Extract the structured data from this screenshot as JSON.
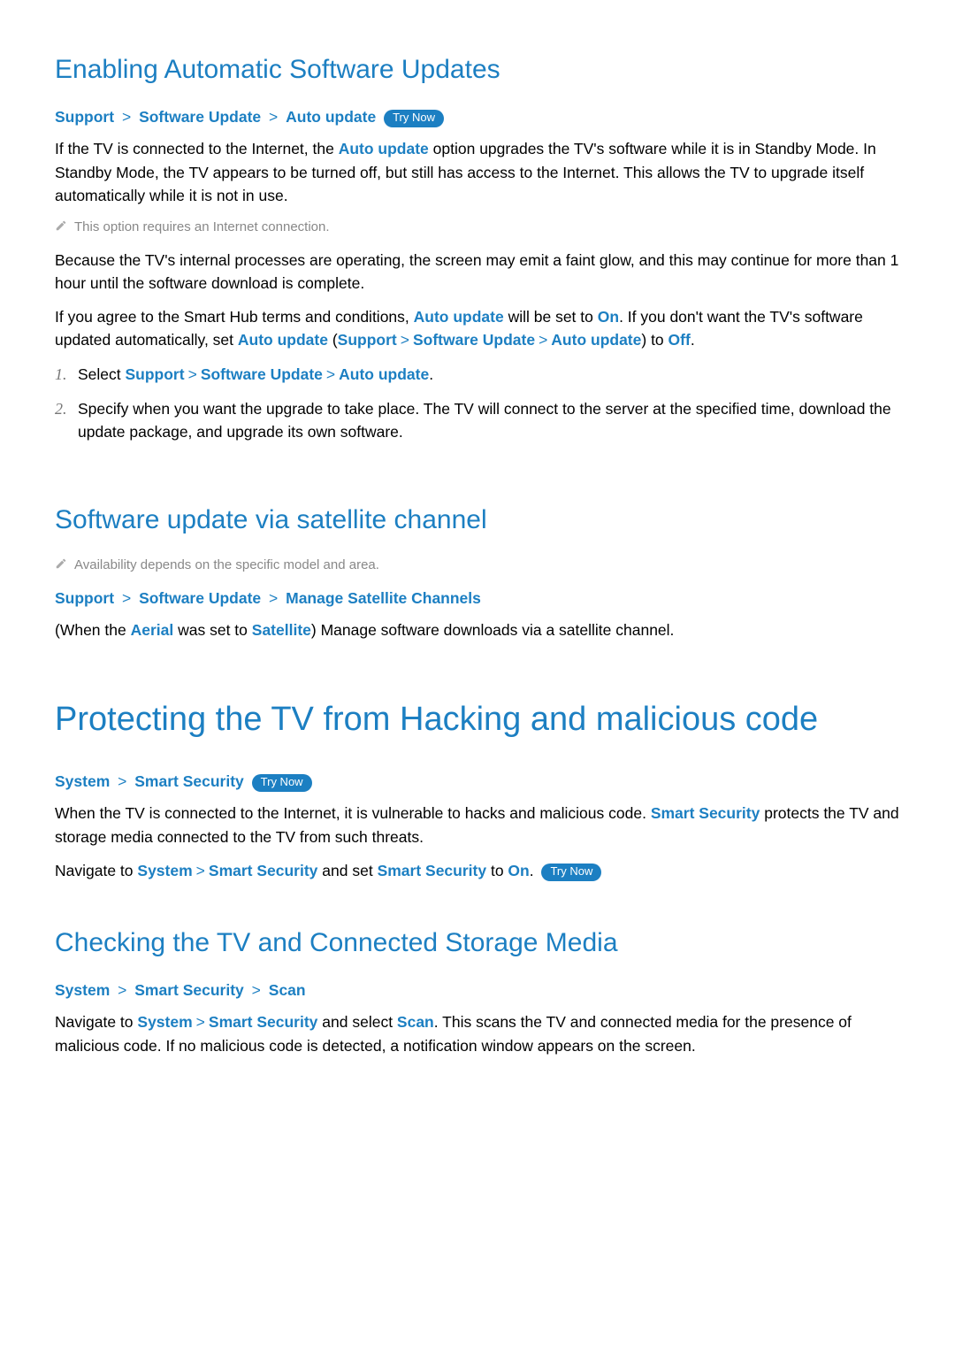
{
  "sec1": {
    "title": "Enabling Automatic Software Updates",
    "bc": {
      "a": "Support",
      "b": "Software Update",
      "c": "Auto update",
      "try": "Try Now"
    },
    "p1a": "If the TV is connected to the Internet, the ",
    "p1b": "Auto update",
    "p1c": " option upgrades the TV's software while it is in Standby Mode. In Standby Mode, the TV appears to be turned off, but still has access to the Internet. This allows the TV to upgrade itself automatically while it is not in use.",
    "note1": "This option requires an Internet connection.",
    "p2": "Because the TV's internal processes are operating, the screen may emit a faint glow, and this may continue for more than 1 hour until the software download is complete.",
    "p3a": "If you agree to the Smart Hub terms and conditions, ",
    "p3b": "Auto update",
    "p3c": " will be set to ",
    "p3d": "On",
    "p3e": ". If you don't want the TV's software updated automatically, set ",
    "p3f": "Auto update",
    "p3g": " (",
    "p3h": "Support",
    "p3i": "Software Update",
    "p3j": "Auto update",
    "p3k": ") to ",
    "p3l": "Off",
    "p3m": ".",
    "step1a": "Select ",
    "step1b": "Support",
    "step1c": "Software Update",
    "step1d": "Auto update",
    "step1e": ".",
    "step2": "Specify when you want the upgrade to take place. The TV will connect to the server at the specified time, download the update package, and upgrade its own software."
  },
  "sec2": {
    "title": "Software update via satellite channel",
    "note": "Availability depends on the specific model and area.",
    "bc": {
      "a": "Support",
      "b": "Software Update",
      "c": "Manage Satellite Channels"
    },
    "p1a": "(When the ",
    "p1b": "Aerial",
    "p1c": " was set to ",
    "p1d": "Satellite",
    "p1e": ") Manage software downloads via a satellite channel."
  },
  "sec3": {
    "title": "Protecting the TV from Hacking and malicious code",
    "bc": {
      "a": "System",
      "b": "Smart Security",
      "try": "Try Now"
    },
    "p1a": "When the TV is connected to the Internet, it is vulnerable to hacks and malicious code. ",
    "p1b": "Smart Security",
    "p1c": " protects the TV and storage media connected to the TV from such threats.",
    "p2a": "Navigate to ",
    "p2b": "System",
    "p2c": "Smart Security",
    "p2d": " and set ",
    "p2e": "Smart Security",
    "p2f": " to ",
    "p2g": "On",
    "p2h": ". ",
    "try": "Try Now"
  },
  "sec4": {
    "title": "Checking the TV and Connected Storage Media",
    "bc": {
      "a": "System",
      "b": "Smart Security",
      "c": "Scan"
    },
    "p1a": "Navigate to ",
    "p1b": "System",
    "p1c": "Smart Security",
    "p1d": " and select ",
    "p1e": "Scan",
    "p1f": ". This scans the TV and connected media for the presence of malicious code. If no malicious code is detected, a notification window appears on the screen."
  },
  "nums": {
    "n1": "1.",
    "n2": "2."
  },
  "sep": ">"
}
